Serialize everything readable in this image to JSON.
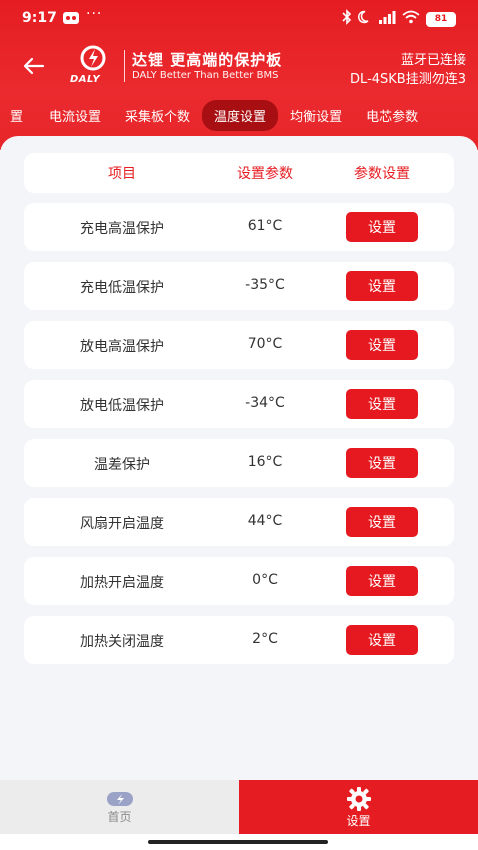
{
  "status_bar": {
    "time": "9:17",
    "dots": "···",
    "battery": "81"
  },
  "header": {
    "logo_text": "DALY",
    "brand_title": "达锂 更高端的保护板",
    "brand_subtitle": "DALY Better Than Better BMS",
    "connection_status": "蓝牙已连接",
    "device_name": "DL-4SKB挂测勿连3"
  },
  "tabs": [
    {
      "label": "置",
      "active": false
    },
    {
      "label": "电流设置",
      "active": false
    },
    {
      "label": "采集板个数",
      "active": false
    },
    {
      "label": "温度设置",
      "active": true
    },
    {
      "label": "均衡设置",
      "active": false
    },
    {
      "label": "电芯参数",
      "active": false
    }
  ],
  "table": {
    "headers": [
      "项目",
      "设置参数",
      "参数设置"
    ],
    "rows": [
      {
        "item": "充电高温保护",
        "value": "61°C",
        "button": "设置"
      },
      {
        "item": "充电低温保护",
        "value": "-35°C",
        "button": "设置"
      },
      {
        "item": "放电高温保护",
        "value": "70°C",
        "button": "设置"
      },
      {
        "item": "放电低温保护",
        "value": "-34°C",
        "button": "设置"
      },
      {
        "item": "温差保护",
        "value": "16°C",
        "button": "设置"
      },
      {
        "item": "风扇开启温度",
        "value": "44°C",
        "button": "设置"
      },
      {
        "item": "加热开启温度",
        "value": "0°C",
        "button": "设置"
      },
      {
        "item": "加热关闭温度",
        "value": "2°C",
        "button": "设置"
      }
    ]
  },
  "bottom_nav": {
    "home_label": "首页",
    "settings_label": "设置"
  },
  "colors": {
    "brand_red": "#e51d22",
    "active_tab": "#a80f12",
    "background": "#f4f5f9"
  }
}
